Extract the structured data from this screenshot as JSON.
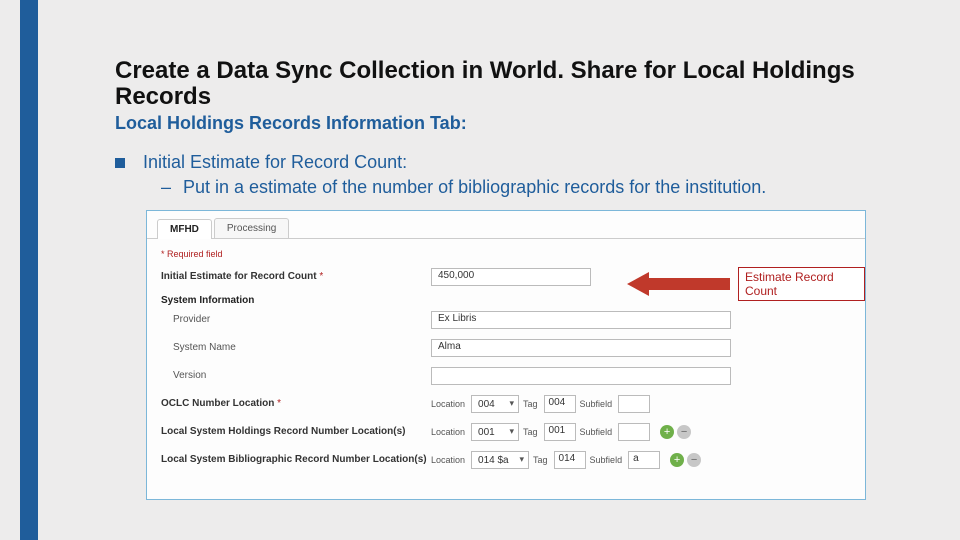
{
  "title": "Create a Data Sync Collection in World. Share for Local Holdings Records",
  "subtitle": "Local Holdings Records Information Tab:",
  "bullet": "Initial Estimate for Record Count:",
  "subbullet": "Put in a estimate of the number of bibliographic records for the institution.",
  "panel": {
    "tabs": {
      "mfhd": "MFHD",
      "processing": "Processing"
    },
    "required_note": "* Required field",
    "labels": {
      "estimate": "Initial Estimate for Record Count",
      "system_info": "System Information",
      "provider": "Provider",
      "system_name": "System Name",
      "version": "Version",
      "oclc_loc": "OCLC Number Location",
      "lshrn": "Local System Holdings Record Number Location(s)",
      "lsbrn": "Local System Bibliographic Record Number Location(s)",
      "location": "Location",
      "tag": "Tag",
      "subfield": "Subfield"
    },
    "values": {
      "estimate": "450,000",
      "provider": "Ex Libris",
      "system_name": "Alma",
      "version": "",
      "oclc": {
        "loc": "004",
        "tag": "004",
        "sub": ""
      },
      "lshrn": {
        "loc": "001",
        "tag": "001",
        "sub": ""
      },
      "lsbrn": {
        "loc": "014 $a",
        "tag": "014",
        "sub": "a"
      }
    },
    "callout": "Estimate Record Count"
  }
}
